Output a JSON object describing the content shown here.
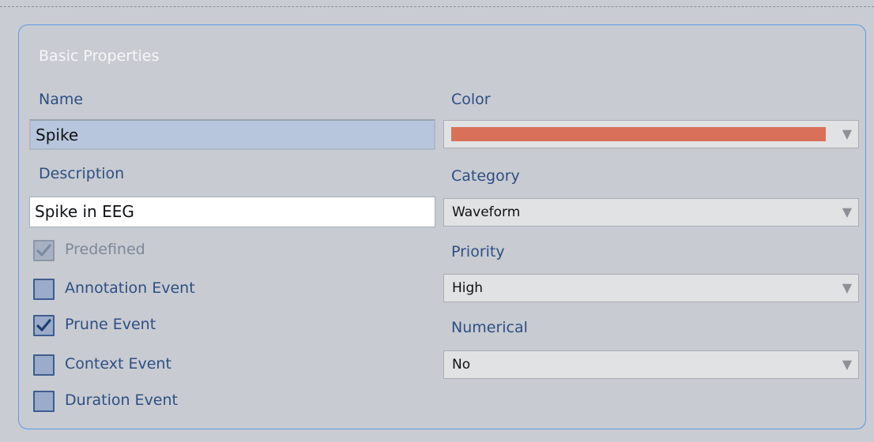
{
  "panel": {
    "title": "Basic Properties"
  },
  "left": {
    "name_label": "Name",
    "name_value": "Spike",
    "description_label": "Description",
    "description_value": "Spike in EEG",
    "checkboxes": [
      {
        "label": "Predefined",
        "checked": true,
        "disabled": true
      },
      {
        "label": "Annotation Event",
        "checked": false,
        "disabled": false
      },
      {
        "label": "Prune Event",
        "checked": true,
        "disabled": false
      },
      {
        "label": "Context Event",
        "checked": false,
        "disabled": false
      },
      {
        "label": "Duration Event",
        "checked": false,
        "disabled": false
      }
    ]
  },
  "right": {
    "color_label": "Color",
    "color_value": "#d9705a",
    "category_label": "Category",
    "category_value": "Waveform",
    "priority_label": "Priority",
    "priority_value": "High",
    "numerical_label": "Numerical",
    "numerical_value": "No"
  },
  "icons": {
    "dropdown": "chevron-down-icon",
    "check": "check-icon"
  },
  "colors": {
    "panel_border": "#5b9ae6",
    "label_text": "#2d4f83",
    "background": "#c9ccd2"
  }
}
